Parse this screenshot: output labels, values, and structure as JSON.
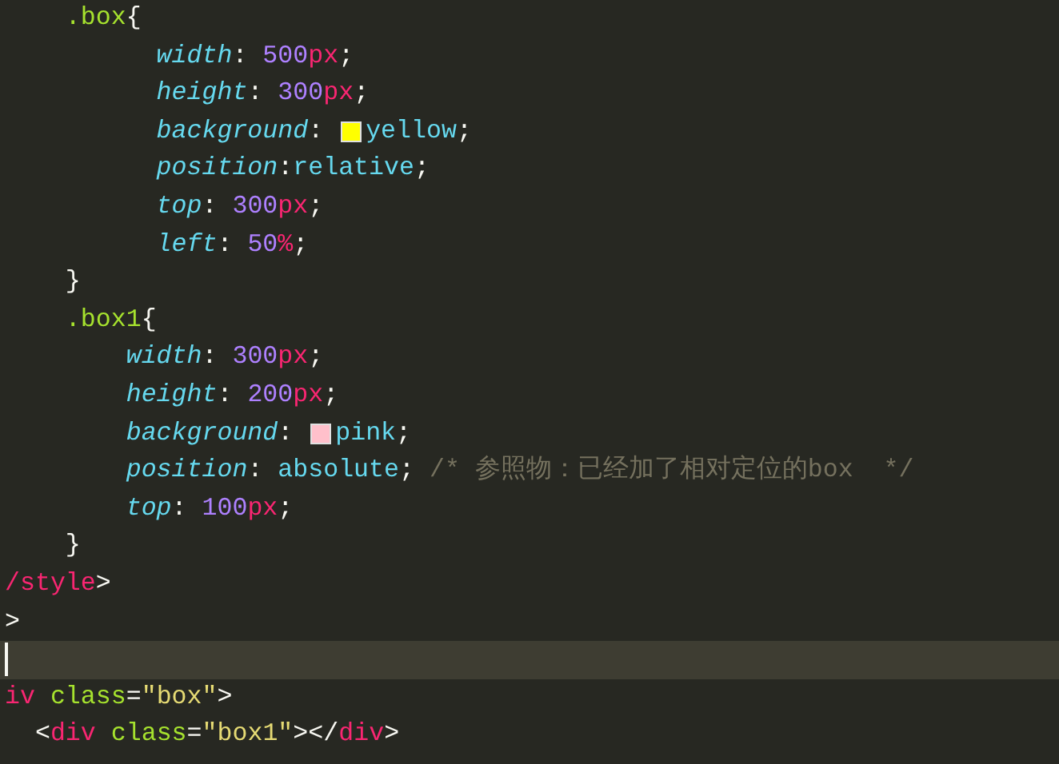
{
  "editor": {
    "lines": [
      {
        "current": false,
        "tokens": [
          {
            "kind": "selector",
            "text": "    .box"
          },
          {
            "kind": "punct",
            "text": "{"
          }
        ]
      },
      {
        "current": false,
        "tokens": [
          {
            "kind": "property",
            "text": "          width"
          },
          {
            "kind": "punct",
            "text": ": "
          },
          {
            "kind": "number",
            "text": "500"
          },
          {
            "kind": "unit",
            "text": "px"
          },
          {
            "kind": "punct",
            "text": ";"
          }
        ]
      },
      {
        "current": false,
        "tokens": [
          {
            "kind": "property",
            "text": "          height"
          },
          {
            "kind": "punct",
            "text": ": "
          },
          {
            "kind": "number",
            "text": "300"
          },
          {
            "kind": "unit",
            "text": "px"
          },
          {
            "kind": "punct",
            "text": ";"
          }
        ]
      },
      {
        "current": false,
        "tokens": [
          {
            "kind": "property",
            "text": "          background"
          },
          {
            "kind": "punct",
            "text": ": "
          },
          {
            "kind": "swatch",
            "color": "#ffff00"
          },
          {
            "kind": "value",
            "text": "yellow"
          },
          {
            "kind": "punct",
            "text": ";"
          }
        ]
      },
      {
        "current": false,
        "tokens": [
          {
            "kind": "property",
            "text": "          position"
          },
          {
            "kind": "punct",
            "text": ":"
          },
          {
            "kind": "value",
            "text": "relative"
          },
          {
            "kind": "punct",
            "text": ";"
          }
        ]
      },
      {
        "current": false,
        "tokens": [
          {
            "kind": "property",
            "text": "          top"
          },
          {
            "kind": "punct",
            "text": ": "
          },
          {
            "kind": "number",
            "text": "300"
          },
          {
            "kind": "unit",
            "text": "px"
          },
          {
            "kind": "punct",
            "text": ";"
          }
        ]
      },
      {
        "current": false,
        "tokens": [
          {
            "kind": "property",
            "text": "          left"
          },
          {
            "kind": "punct",
            "text": ": "
          },
          {
            "kind": "number",
            "text": "50"
          },
          {
            "kind": "unit",
            "text": "%"
          },
          {
            "kind": "punct",
            "text": ";"
          }
        ]
      },
      {
        "current": false,
        "tokens": [
          {
            "kind": "punct",
            "text": "    }"
          }
        ]
      },
      {
        "current": false,
        "tokens": [
          {
            "kind": "selector",
            "text": "    .box1"
          },
          {
            "kind": "punct",
            "text": "{"
          }
        ]
      },
      {
        "current": false,
        "tokens": [
          {
            "kind": "property",
            "text": "        width"
          },
          {
            "kind": "punct",
            "text": ": "
          },
          {
            "kind": "number",
            "text": "300"
          },
          {
            "kind": "unit",
            "text": "px"
          },
          {
            "kind": "punct",
            "text": ";"
          }
        ]
      },
      {
        "current": false,
        "tokens": [
          {
            "kind": "property",
            "text": "        height"
          },
          {
            "kind": "punct",
            "text": ": "
          },
          {
            "kind": "number",
            "text": "200"
          },
          {
            "kind": "unit",
            "text": "px"
          },
          {
            "kind": "punct",
            "text": ";"
          }
        ]
      },
      {
        "current": false,
        "tokens": [
          {
            "kind": "property",
            "text": "        background"
          },
          {
            "kind": "punct",
            "text": ": "
          },
          {
            "kind": "swatch",
            "color": "#ffc0cb"
          },
          {
            "kind": "value",
            "text": "pink"
          },
          {
            "kind": "punct",
            "text": ";"
          }
        ]
      },
      {
        "current": false,
        "tokens": [
          {
            "kind": "property",
            "text": "        position"
          },
          {
            "kind": "punct",
            "text": ": "
          },
          {
            "kind": "value",
            "text": "absolute"
          },
          {
            "kind": "punct",
            "text": "; "
          },
          {
            "kind": "comment",
            "text": "/* 参照物：已经加了相对定位的box  */"
          }
        ]
      },
      {
        "current": false,
        "tokens": [
          {
            "kind": "property",
            "text": "        top"
          },
          {
            "kind": "punct",
            "text": ": "
          },
          {
            "kind": "number",
            "text": "100"
          },
          {
            "kind": "unit",
            "text": "px"
          },
          {
            "kind": "punct",
            "text": ";"
          }
        ]
      },
      {
        "current": false,
        "tokens": [
          {
            "kind": "punct",
            "text": "    }"
          }
        ]
      },
      {
        "current": false,
        "tokens": [
          {
            "kind": "tag",
            "text": "/style"
          },
          {
            "kind": "punct",
            "text": ">"
          }
        ]
      },
      {
        "current": false,
        "tokens": [
          {
            "kind": "punct",
            "text": ">"
          }
        ]
      },
      {
        "current": true
      },
      {
        "current": false,
        "tokens": [
          {
            "kind": "tag",
            "text": "iv"
          },
          {
            "kind": "attr",
            "text": " class"
          },
          {
            "kind": "punct",
            "text": "="
          },
          {
            "kind": "string",
            "text": "\"box\""
          },
          {
            "kind": "punct",
            "text": ">"
          }
        ]
      },
      {
        "current": false,
        "tokens": [
          {
            "kind": "punct",
            "text": "  <"
          },
          {
            "kind": "tag",
            "text": "div"
          },
          {
            "kind": "attr",
            "text": " class"
          },
          {
            "kind": "punct",
            "text": "="
          },
          {
            "kind": "string",
            "text": "\"box1\""
          },
          {
            "kind": "punct",
            "text": "></"
          },
          {
            "kind": "tag",
            "text": "div"
          },
          {
            "kind": "punct",
            "text": ">"
          }
        ]
      }
    ]
  }
}
